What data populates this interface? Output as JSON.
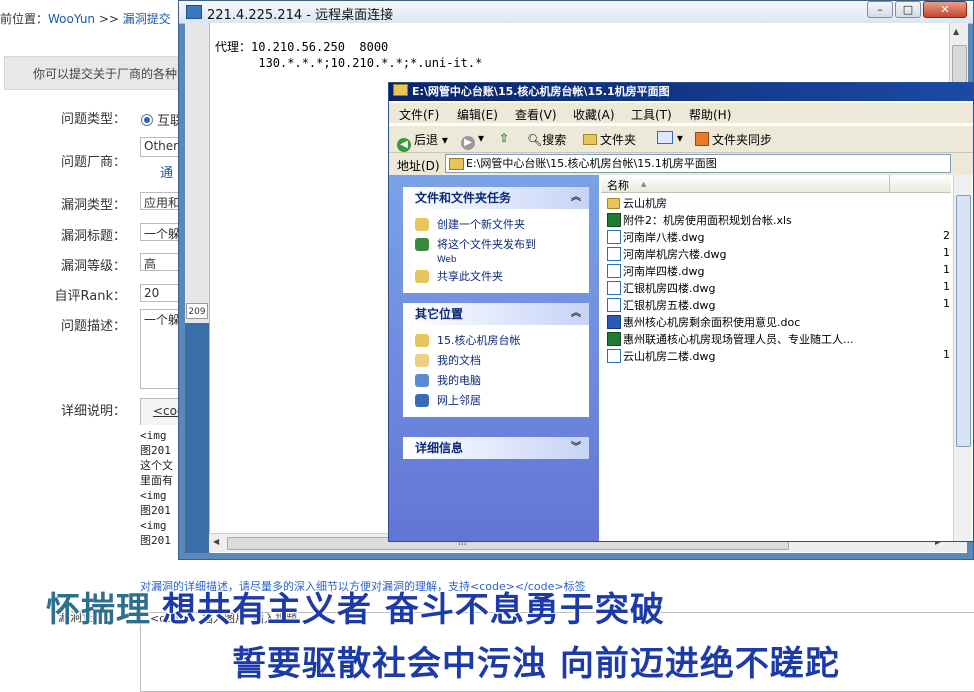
{
  "form": {
    "breadcrumb_prefix": "前位置：",
    "breadcrumb_site": "WooYun",
    "breadcrumb_sep": ">>",
    "breadcrumb_page": "漏洞提交",
    "notice": "你可以提交关于厂商的各种",
    "labels": {
      "problem_type": "问题类型：",
      "vendor": "问题厂商：",
      "vuln_type": "漏洞类型：",
      "vuln_title": "漏洞标题：",
      "vuln_level": "漏洞等级：",
      "self_rank": "自评Rank：",
      "problem_desc": "问题描述：",
      "detail": "详细说明："
    },
    "problem_type_value": "互联",
    "vendor_value": "Other",
    "vendor_link": "通",
    "vuln_type_value": "应用和",
    "vuln_title_value": "一个躲",
    "vuln_level_value": "高",
    "self_rank_value": "20",
    "desc_value": "一个躲",
    "detail_tab": "<cod",
    "code_lines": [
      "<img",
      "图201",
      "这个文",
      "里面有",
      "<img",
      "图201",
      "<img",
      "图201"
    ],
    "hint": "对漏洞的详细描述，请尽量多的深入细节以方便对漏洞的理解，支持<code></code>标签",
    "bottom_label": "漏洞证明",
    "bottom_toolbar": "<code>  插入图片  插入视频"
  },
  "remote": {
    "title": "221.4.225.214 - 远程桌面连接",
    "min": "–",
    "max": "□",
    "close": "✕",
    "proxy_line1": "代理：10.210.56.250  8000",
    "proxy_line2": "      130.*.*.*;10.210.*.*;*.uni-it.*",
    "left_tag": "209"
  },
  "explorer": {
    "title": "E:\\网管中心台账\\15.核心机房台帐\\15.1机房平面图",
    "menus": [
      "文件(F)",
      "编辑(E)",
      "查看(V)",
      "收藏(A)",
      "工具(T)",
      "帮助(H)"
    ],
    "toolbar": {
      "back": "后退",
      "search": "搜索",
      "folders": "文件夹",
      "sync": "文件夹同步"
    },
    "address_label": "地址(D)",
    "address_value": "E:\\网管中心台账\\15.核心机房台帐\\15.1机房平面图",
    "tasks_header": "文件和文件夹任务",
    "tasks": [
      "创建一个新文件夹",
      "将这个文件夹发布到",
      "Web",
      "共享此文件夹"
    ],
    "other_header": "其它位置",
    "other_places": [
      "15.核心机房台帐",
      "我的文档",
      "我的电脑",
      "网上邻居"
    ],
    "details_header": "详细信息",
    "col_name": "名称",
    "sort_arrow": "▲",
    "files": [
      {
        "name": "云山机房",
        "icon": "folder-icon",
        "size": ""
      },
      {
        "name": "附件2：机房使用面积规划台帐.xls",
        "icon": "excel-icon",
        "size": ""
      },
      {
        "name": "河南岸八楼.dwg",
        "icon": "dwg-icon",
        "size": "2"
      },
      {
        "name": "河南岸机房六楼.dwg",
        "icon": "dwg-icon",
        "size": "1"
      },
      {
        "name": "河南岸四楼.dwg",
        "icon": "dwg-icon",
        "size": "1"
      },
      {
        "name": "汇银机房四楼.dwg",
        "icon": "dwg-icon",
        "size": "1"
      },
      {
        "name": "汇银机房五楼.dwg",
        "icon": "dwg-icon",
        "size": "1"
      },
      {
        "name": "惠州核心机房剩余面积使用意见.doc",
        "icon": "word-icon",
        "size": ""
      },
      {
        "name": "惠州联通核心机房现场管理人员、专业随工人...",
        "icon": "excel-icon",
        "size": ""
      },
      {
        "name": "云山机房二楼.dwg",
        "icon": "dwg-icon",
        "size": "1"
      }
    ]
  },
  "subtitles": {
    "line1_a": "怀揣理",
    "line1_b": "想共有主义者  奋斗不息勇于突破",
    "line2": "誓要驱散社会中污浊  向前迈进绝不蹉跎"
  }
}
